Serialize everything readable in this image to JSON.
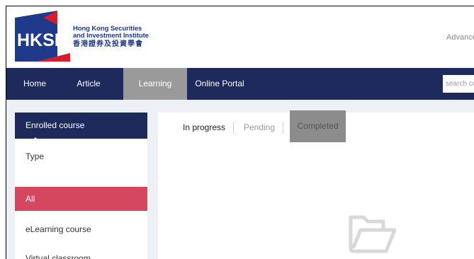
{
  "header": {
    "logo_mark_text": "HKSI",
    "logo_en_line1": "Hong Kong Securities",
    "logo_en_line2": "and Investment Institute",
    "logo_zh": "香港證券及投資學會",
    "advance_link": "Advance"
  },
  "nav": {
    "items": [
      {
        "label": "Home"
      },
      {
        "label": "Article"
      },
      {
        "label": "Learning",
        "active": true
      },
      {
        "label": "Online Portal"
      }
    ],
    "search_placeholder": "search courses"
  },
  "sidebar": {
    "header": "Enrolled course",
    "type_label": "Type",
    "items": [
      {
        "label": "All",
        "selected": true
      },
      {
        "label": "eLearning course"
      },
      {
        "label": "Virtual classroom"
      }
    ]
  },
  "tabs": [
    {
      "label": "In progress",
      "state": "current"
    },
    {
      "label": "Pending",
      "state": "normal"
    },
    {
      "label": "Completed",
      "state": "highlighted"
    }
  ],
  "empty_state": {
    "icon": "open-folder-icon"
  },
  "colors": {
    "navy": "#1e2a5c",
    "active_nav": "#9a9a9a",
    "selected_item": "#d4475e",
    "logo_red": "#d11f2f",
    "logo_blue": "#1f3a8a",
    "content_bg": "#edf0f4"
  }
}
